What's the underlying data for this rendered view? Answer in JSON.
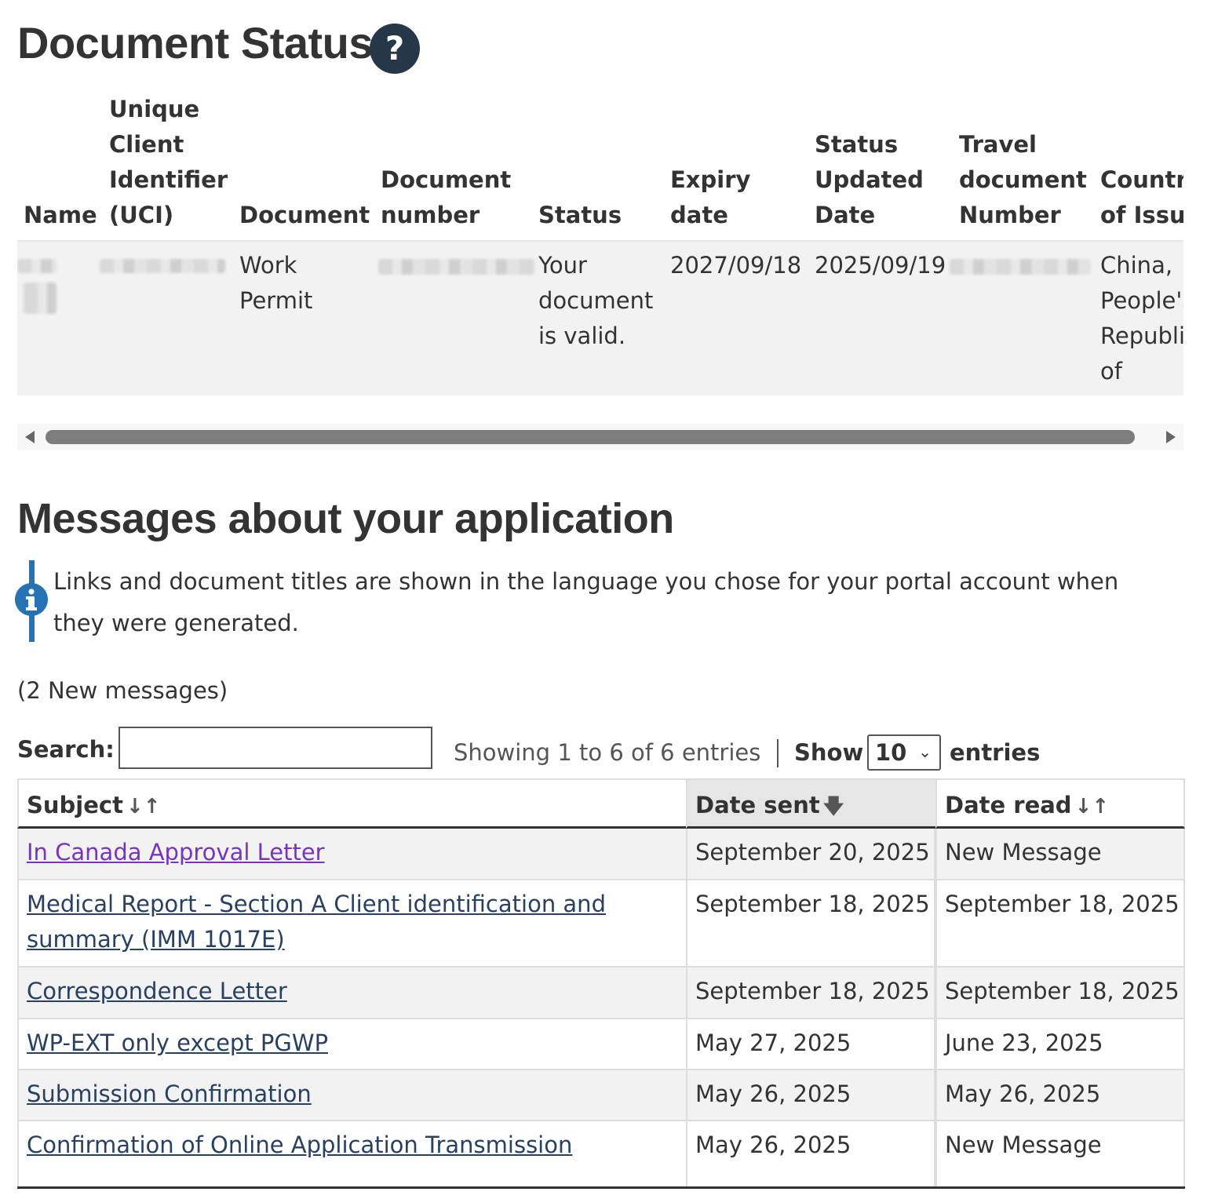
{
  "doc_status": {
    "title": "Document Status",
    "help_icon": "question-circle-icon",
    "headers": {
      "name": "Name",
      "uci_1": "Unique",
      "uci_2": "Client",
      "uci_3": "Identifier",
      "uci_4": "(UCI)",
      "document": "Document",
      "docnum_1": "Document",
      "docnum_2": "number",
      "status": "Status",
      "expiry_1": "Expiry",
      "expiry_2": "date",
      "updated_1": "Status",
      "updated_2": "Updated",
      "updated_3": "Date",
      "travel_1": "Travel",
      "travel_2": "document",
      "travel_3": "Number",
      "country_1": "Country",
      "country_2": "of Issue"
    },
    "row": {
      "document_1": "Work",
      "document_2": "Permit",
      "status_1": "Your",
      "status_2": "document",
      "status_3": "is valid.",
      "expiry": "2027/09/18",
      "updated": "2025/09/19",
      "country_1": "China,",
      "country_2": "People's",
      "country_3": "Republic",
      "country_4": "of"
    }
  },
  "messages": {
    "title": "Messages about your application",
    "info_icon": "info-circle-icon",
    "info_text": "Links and document titles are shown in the language you chose for your portal account when they were generated.",
    "new_count": "(2 New messages)",
    "search_label": "Search:",
    "search_value": "",
    "showing": "Showing 1 to 6 of 6 entries",
    "show_label": "Show",
    "page_size": "10",
    "entries_label": "entries",
    "columns": {
      "subject": "Subject",
      "date_sent": "Date sent",
      "date_read": "Date read"
    },
    "rows": [
      {
        "subject": "In Canada Approval Letter",
        "sent": "September 20, 2025",
        "read": "New Message"
      },
      {
        "subject": "Medical Report - Section A Client identification and summary (IMM 1017E)",
        "sent": "September 18, 2025",
        "read": "September 18, 2025"
      },
      {
        "subject": "Correspondence Letter",
        "sent": "September 18, 2025",
        "read": "September 18, 2025"
      },
      {
        "subject": "WP-EXT only except PGWP",
        "sent": "May 27, 2025",
        "read": "June 23, 2025"
      },
      {
        "subject": "Submission Confirmation",
        "sent": "May 26, 2025",
        "read": "May 26, 2025"
      },
      {
        "subject": "Confirmation of Online Application Transmission",
        "sent": "May 26, 2025",
        "read": "New Message"
      }
    ]
  },
  "colors": {
    "heading": "#333333",
    "link": "#284162",
    "visited_link": "#7834bc",
    "help_icon_bg": "#26374a",
    "info_accent": "#2572b4",
    "row_alt": "#f2f2f2",
    "sorted_header_bg": "#e6e6e6"
  }
}
